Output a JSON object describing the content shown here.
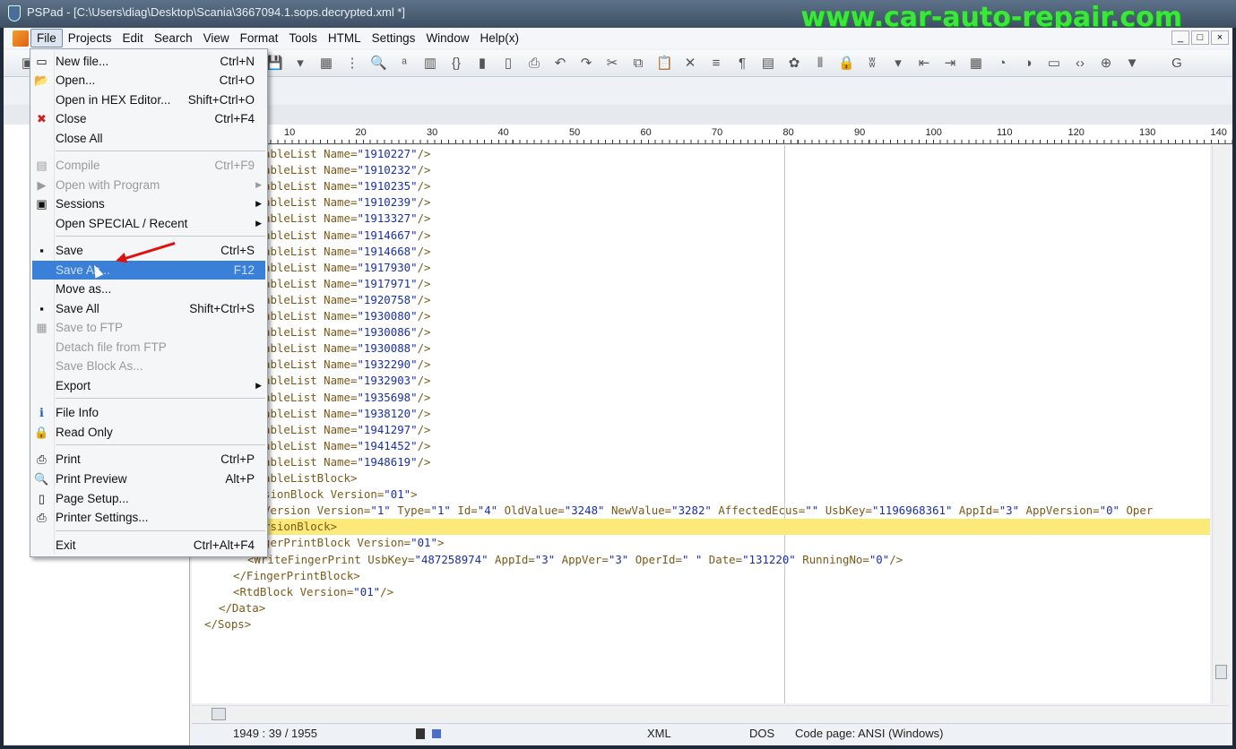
{
  "title": "PSPad - [C:\\Users\\diag\\Desktop\\Scania\\3667094.1.sops.decrypted.xml *]",
  "watermark": "www.car-auto-repair.com",
  "menubar": [
    "File",
    "Projects",
    "Edit",
    "Search",
    "View",
    "Format",
    "Tools",
    "HTML",
    "Settings",
    "Window",
    "Help(x)"
  ],
  "window_buttons": [
    "_",
    "□",
    "×"
  ],
  "ruler": [
    "10",
    "20",
    "30",
    "40",
    "50",
    "60",
    "70",
    "80",
    "90",
    "100",
    "110",
    "120",
    "130",
    "140"
  ],
  "file_menu": [
    {
      "label": "New file...",
      "shortcut": "Ctrl+N",
      "icon": "new-file-icon",
      "glyph": "▭"
    },
    {
      "label": "Open...",
      "shortcut": "Ctrl+O",
      "icon": "open-folder-icon",
      "glyph": "📂"
    },
    {
      "label": "Open in HEX Editor...",
      "shortcut": "Shift+Ctrl+O"
    },
    {
      "label": "Close",
      "shortcut": "Ctrl+F4",
      "icon": "close-icon",
      "glyph": "✖"
    },
    {
      "label": "Close All",
      "shortcut": ""
    },
    {
      "label": "Compile",
      "shortcut": "Ctrl+F9",
      "disabled": true,
      "icon": "compile-icon",
      "glyph": "▤"
    },
    {
      "label": "Open with Program",
      "shortcut": "",
      "disabled": true,
      "submenu": true,
      "icon": "program-icon",
      "glyph": "▶"
    },
    {
      "label": "Sessions",
      "shortcut": "",
      "submenu": true,
      "icon": "sessions-icon",
      "glyph": "▣"
    },
    {
      "label": "Open     SPECIAL / Recent",
      "shortcut": "",
      "submenu": true
    },
    {
      "label": "Save",
      "shortcut": "Ctrl+S",
      "icon": "save-icon",
      "glyph": "▪"
    },
    {
      "label": "Save As...",
      "shortcut": "F12",
      "selected": true
    },
    {
      "label": "Move as...",
      "shortcut": ""
    },
    {
      "label": "Save All",
      "shortcut": "Shift+Ctrl+S",
      "icon": "save-all-icon",
      "glyph": "▪"
    },
    {
      "label": "Save to FTP",
      "shortcut": "",
      "disabled": true,
      "icon": "ftp-icon",
      "glyph": "▦"
    },
    {
      "label": "Detach file from FTP",
      "shortcut": "",
      "disabled": true
    },
    {
      "label": "Save Block As...",
      "shortcut": "",
      "disabled": true
    },
    {
      "label": "Export",
      "shortcut": "",
      "submenu": true
    },
    {
      "label": "File Info",
      "shortcut": "",
      "icon": "info-icon",
      "glyph": "ℹ"
    },
    {
      "label": "Read Only",
      "shortcut": "",
      "icon": "lock-icon",
      "glyph": "🔒"
    },
    {
      "label": "Print",
      "shortcut": "Ctrl+P",
      "icon": "print-icon",
      "glyph": "⎙"
    },
    {
      "label": "Print Preview",
      "shortcut": "Alt+P",
      "icon": "print-preview-icon",
      "glyph": "🔍"
    },
    {
      "label": "Page Setup...",
      "shortcut": "",
      "icon": "page-setup-icon",
      "glyph": "▯"
    },
    {
      "label": "Printer Settings...",
      "shortcut": "",
      "icon": "printer-settings-icon",
      "glyph": "⎙"
    },
    {
      "label": "Exit",
      "shortcut": "Ctrl+Alt+F4"
    }
  ],
  "code_lines": [
    {
      "indent": 80,
      "text": "ableList Name=\"1910227\"/>"
    },
    {
      "indent": 80,
      "text": "ableList Name=\"1910232\"/>"
    },
    {
      "indent": 80,
      "text": "ableList Name=\"1910235\"/>"
    },
    {
      "indent": 80,
      "text": "ableList Name=\"1910239\"/>"
    },
    {
      "indent": 80,
      "text": "ableList Name=\"1913327\"/>"
    },
    {
      "indent": 80,
      "text": "ableList Name=\"1914667\"/>"
    },
    {
      "indent": 80,
      "text": "ableList Name=\"1914668\"/>"
    },
    {
      "indent": 80,
      "text": "ableList Name=\"1917930\"/>"
    },
    {
      "indent": 80,
      "text": "ableList Name=\"1917971\"/>"
    },
    {
      "indent": 80,
      "text": "ableList Name=\"1920758\"/>"
    },
    {
      "indent": 80,
      "text": "ableList Name=\"1930080\"/>"
    },
    {
      "indent": 80,
      "text": "ableList Name=\"1930086\"/>"
    },
    {
      "indent": 80,
      "text": "ableList Name=\"1930088\"/>"
    },
    {
      "indent": 80,
      "text": "ableList Name=\"1932290\"/>"
    },
    {
      "indent": 80,
      "text": "ableList Name=\"1932903\"/>"
    },
    {
      "indent": 80,
      "text": "ableList Name=\"1935698\"/>"
    },
    {
      "indent": 80,
      "text": "ableList Name=\"1938120\"/>"
    },
    {
      "indent": 80,
      "text": "ableList Name=\"1941297\"/>"
    },
    {
      "indent": 80,
      "text": "ableList Name=\"1941452\"/>"
    },
    {
      "indent": 80,
      "text": "ableList Name=\"1948619\"/>"
    },
    {
      "indent": 80,
      "text": "ableListBlock>"
    },
    {
      "indent": 80,
      "text": "sionBlock Version=\"01\">"
    },
    {
      "indent": 80,
      "text": "Version Version=\"1\" Type=\"1\" Id=\"4\" OldValue=\"3248\" NewValue=\"3282\" AffectedEcus=\"\" UsbKey=\"1196968361\" AppId=\"3\" AppVersion=\"0\" Oper"
    },
    {
      "indent": 80,
      "text": "rsionBlock>",
      "highlight": true
    },
    {
      "indent": 80,
      "text": "gerPrintBlock Version=\"01\">"
    },
    {
      "indent": 62,
      "text": "<WriteFingerPrint UsbKey=\"487258974\" AppId=\"3\" AppVer=\"3\" OperId=\" \" Date=\"131220\" RunningNo=\"0\"/>"
    },
    {
      "indent": 46,
      "text": "</FingerPrintBlock>"
    },
    {
      "indent": 46,
      "text": "<RtdBlock Version=\"01\"/>"
    },
    {
      "indent": 30,
      "text": "</Data>"
    },
    {
      "indent": 14,
      "text": "</Sops>"
    }
  ],
  "status": {
    "position": "1949 : 39 / 1955",
    "syntax": "XML",
    "line_endings": "DOS",
    "code_page": "Code page: ANSI (Windows)"
  },
  "colors": {
    "highlight": "#fbe97a",
    "selection": "#3a7fd8",
    "value": "#1a2fa8",
    "tag": "#7a5a1a"
  }
}
